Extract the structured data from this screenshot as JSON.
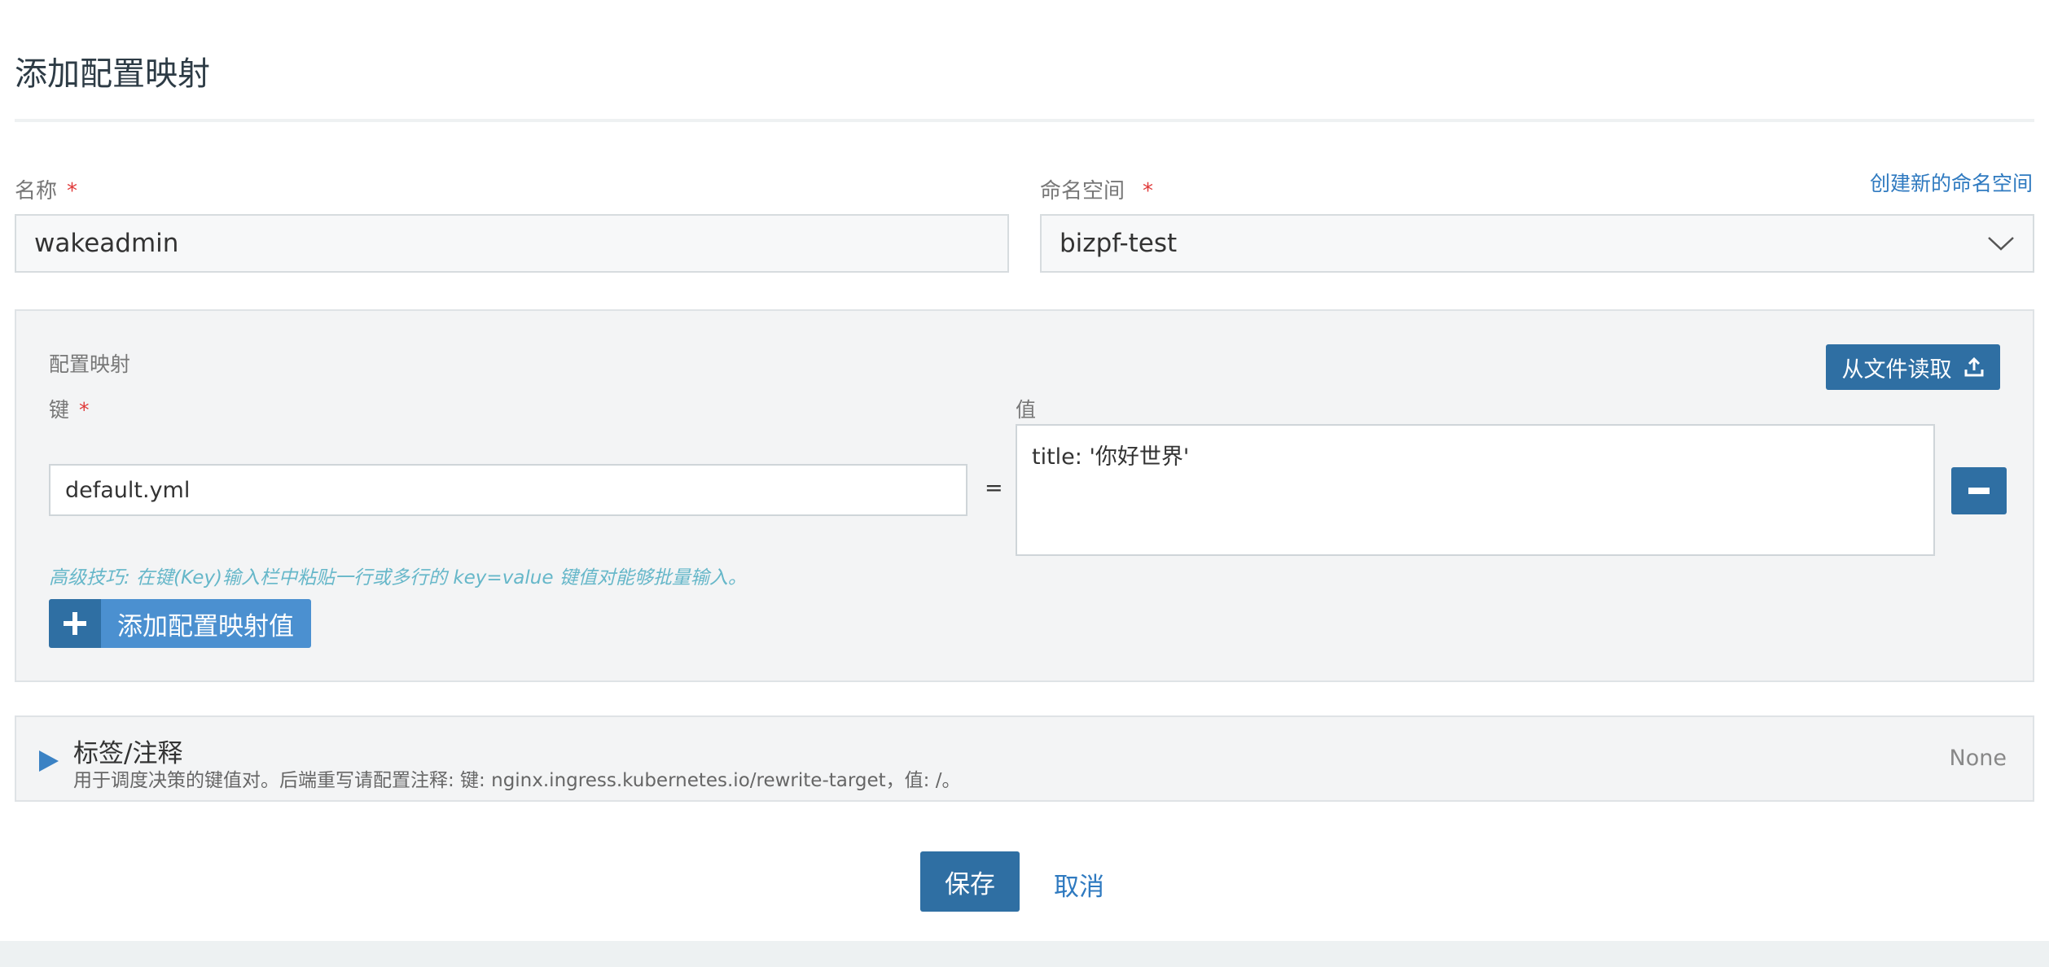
{
  "page": {
    "title": "添加配置映射"
  },
  "form": {
    "name_label": "名称",
    "required_mark": "*",
    "name_value": "wakeadmin",
    "namespace_label": "命名空间",
    "namespace_value": "bizpf-test",
    "create_namespace_link": "创建新的命名空间"
  },
  "config_map": {
    "section_title": "配置映射",
    "read_from_file_label": "从文件读取",
    "key_label": "键",
    "value_label": "值",
    "entries": [
      {
        "key": "default.yml",
        "value": "title: '你好世界'"
      }
    ],
    "equals": "=",
    "tip": "高级技巧: 在键(Key)输入栏中粘贴一行或多行的 key=value 键值对能够批量输入。",
    "add_value_label": "添加配置映射值"
  },
  "labels_annotations": {
    "title": "标签/注释",
    "description": "用于调度决策的键值对。后端重写请配置注释: 键: nginx.ingress.kubernetes.io/rewrite-target，值: /。",
    "status": "None"
  },
  "actions": {
    "save_label": "保存",
    "cancel_label": "取消"
  },
  "colors": {
    "primary": "#2f6fa3",
    "link": "#2f7ac0",
    "required": "#e03a3a",
    "tip": "#66b7c9"
  }
}
